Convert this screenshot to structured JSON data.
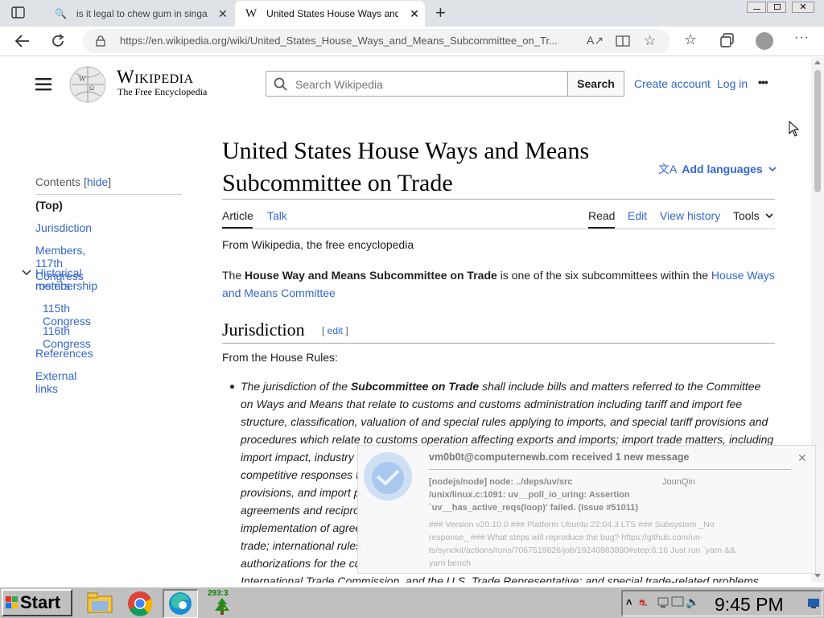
{
  "browser": {
    "tabs": [
      {
        "title": "is it legal to chew gum in singa",
        "active": false
      },
      {
        "title": "United States House Ways and",
        "active": true
      }
    ],
    "new_tab_label": "+",
    "url": "https://en.wikipedia.org/wiki/United_States_House_Ways_and_Means_Subcommittee_on_Tr...",
    "window_buttons": [
      "minimize",
      "restore",
      "close"
    ]
  },
  "wiki": {
    "wordmark": "Wikipedia",
    "tagline": "The Free Encyclopedia",
    "search_placeholder": "Search Wikipedia",
    "search_button": "Search",
    "create_account": "Create account",
    "login": "Log in",
    "more": "•••"
  },
  "toc": {
    "heading": "Contents",
    "hide": "hide",
    "items": [
      {
        "label": "(Top)",
        "level": 0,
        "current": true
      },
      {
        "label": "Jurisdiction",
        "level": 0
      },
      {
        "label": "Members, 117th Congress",
        "level": 0
      },
      {
        "label": "Historical membership",
        "level": 0
      },
      {
        "label": "rosters",
        "level": 0
      },
      {
        "label": "115th Congress",
        "level": 1
      },
      {
        "label": "116th Congress",
        "level": 1
      },
      {
        "label": "References",
        "level": 0
      },
      {
        "label": "External links",
        "level": 0
      }
    ]
  },
  "article": {
    "title_line1": "United States House Ways and Means",
    "title_line2": "Subcommittee on Trade",
    "add_languages": "Add languages",
    "tabs_left": [
      "Article",
      "Talk"
    ],
    "tabs_right": [
      "Read",
      "Edit",
      "View history",
      "Tools"
    ],
    "from": "From Wikipedia, the free encyclopedia",
    "intro": {
      "pre": "The ",
      "bold": "House Way and Means Subcommittee on Trade",
      "mid": " is one of the six subcommittees within the ",
      "link": "House Ways and Means Committee"
    },
    "section_heading": "Jurisdiction",
    "section_edit": "edit",
    "from_rules": "From the House Rules:",
    "bullet": {
      "pre": "The jurisdiction of the ",
      "bold": "Subcommittee on Trade",
      "line1_post": " shall include bills and matters referred to the Committee",
      "line2": "on Ways and Means that relate to customs and customs administration including tariff and import fee",
      "line3": "structure, classification, valuation of and special rules applying to imports, and special tariff provisions and",
      "line4": "procedures which relate to customs operation affecting exports and imports; import trade matters, including",
      "line5": "import impact, industry",
      "line6": "competitive responses t",
      "line7": "provisions, and import p",
      "line8": "agreements and recipro",
      "line9": "implementation of agree",
      "line10": "trade; international rules",
      "line11": "authorizations for the cu",
      "line12": "International Trade Commission, and the U.S. Trade Representative; and special trade-related problems"
    }
  },
  "notification": {
    "title": "vm0b0t@computernewb.com received 1 new message",
    "author": "JounQin",
    "msg1": "[nodejs/node] node: ../deps/uv/src",
    "msg2": "/unix/linux.c:1091: uv__poll_io_uring: Assertion",
    "msg3": "`uv__has_active_reqs(loop)' failed. (Issue #51011)",
    "body1": "### Version v20.10.0 ### Platform Ubuntu 22:04.3 LTS ### Subsystem _No",
    "body2": "response_ ### What steps will reproduce the bug? https://github.com/un-",
    "body3": "ts/synckit/actions/runs/7067518826/job/19240983880#step:6:16 Just run `yarn &&",
    "body4": "yarn bench"
  },
  "taskbar": {
    "start": "Start",
    "badge": "293:3",
    "clock": "9:45 PM"
  },
  "colors": {
    "link": "#3366cc",
    "text": "#202122",
    "tabbar": "#dfe3e8",
    "taskbar": "#c0c0c0"
  }
}
